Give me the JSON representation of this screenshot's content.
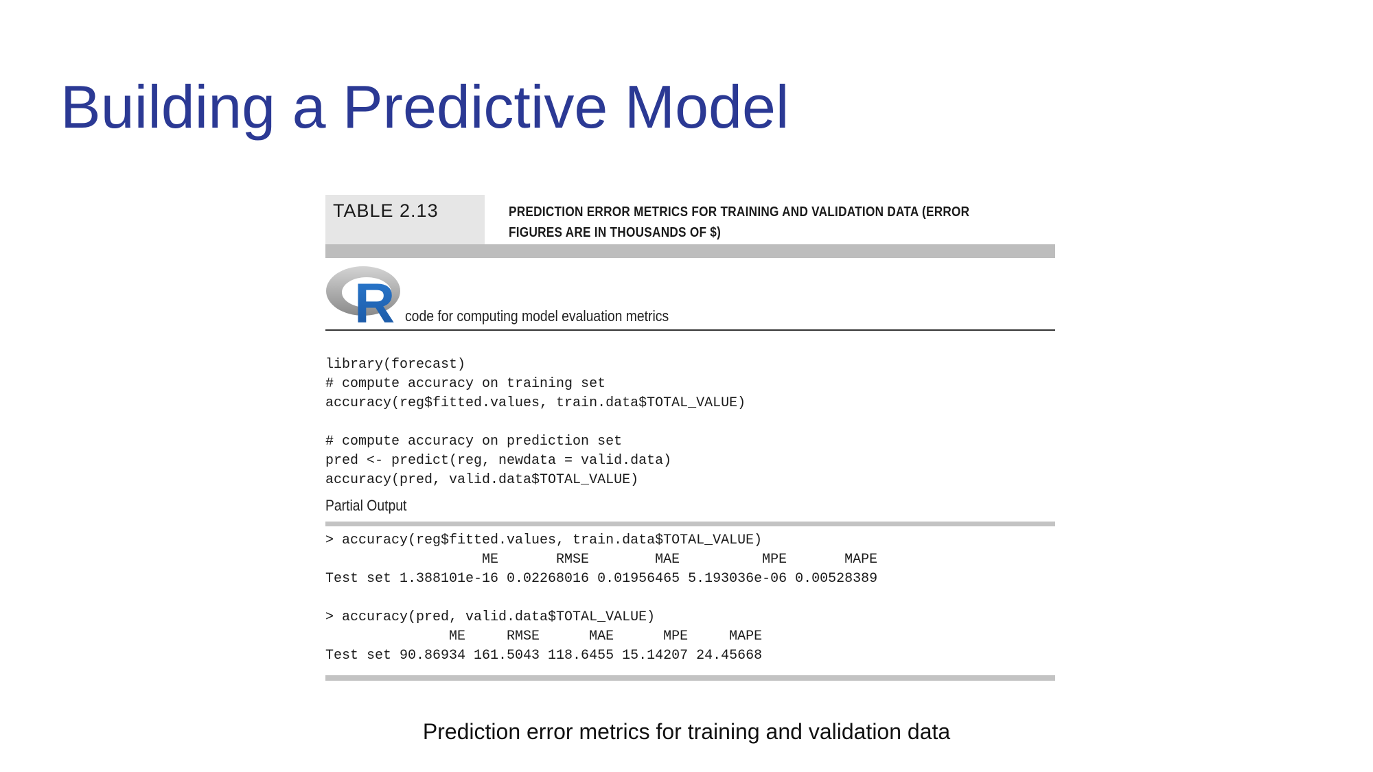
{
  "slide": {
    "title": "Building a Predictive Model",
    "caption": "Prediction error metrics for training and validation data"
  },
  "table": {
    "label": "TABLE 2.13",
    "caption": "PREDICTION ERROR METRICS FOR TRAINING AND VALIDATION DATA (ERROR FIGURES ARE IN THOUSANDS OF $)"
  },
  "r_section": {
    "logo_letter": "R",
    "caption": "code for computing model evaluation metrics"
  },
  "code": {
    "block1": "library(forecast)\n# compute accuracy on training set\naccuracy(reg$fitted.values, train.data$TOTAL_VALUE)",
    "block2": "# compute accuracy on prediction set\npred <- predict(reg, newdata = valid.data)\naccuracy(pred, valid.data$TOTAL_VALUE)"
  },
  "output": {
    "label": "Partial Output",
    "block1": "> accuracy(reg$fitted.values, train.data$TOTAL_VALUE)\n                   ME       RMSE        MAE          MPE       MAPE\nTest set 1.388101e-16 0.02268016 0.01956465 5.193036e-06 0.00528389",
    "block2": "> accuracy(pred, valid.data$TOTAL_VALUE)\n               ME     RMSE      MAE      MPE     MAPE\nTest set 90.86934 161.5043 118.6455 15.14207 24.45668"
  },
  "colors": {
    "title": "#2b3994",
    "r_logo_blue": "#1f65b7",
    "r_logo_ring": "#9a9a9a"
  }
}
